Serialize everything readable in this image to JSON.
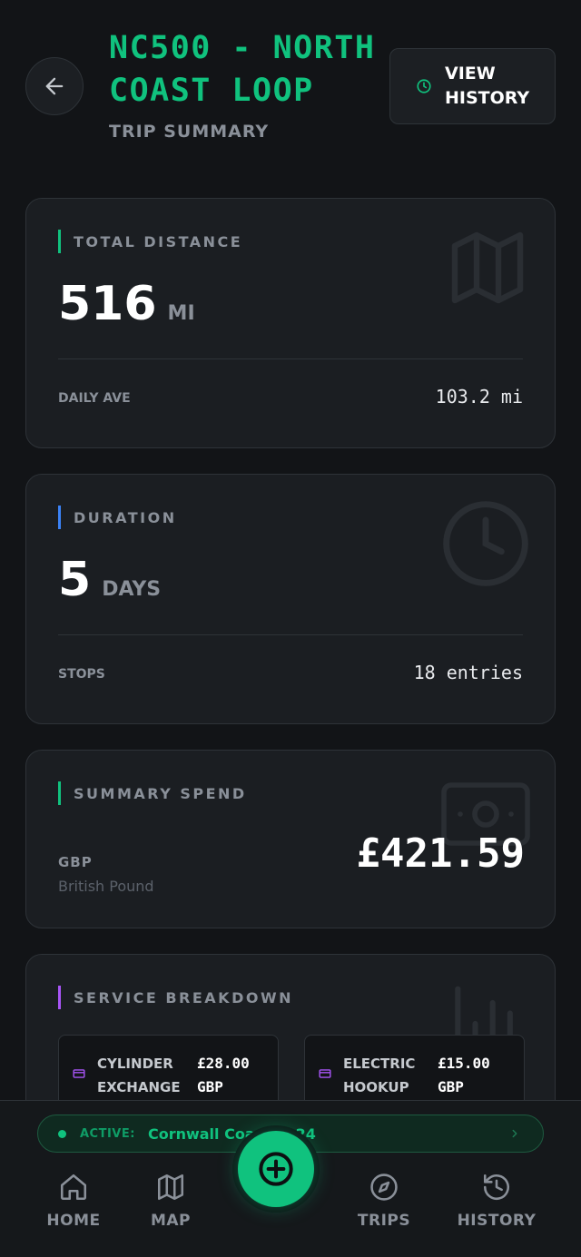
{
  "header": {
    "title": "NC500 - NORTH COAST LOOP",
    "subtitle": "TRIP SUMMARY",
    "history_button": "VIEW HISTORY"
  },
  "distance": {
    "label": "TOTAL DISTANCE",
    "value": "516",
    "unit": "MI",
    "row_key": "DAILY AVE",
    "row_value": "103.2 mi"
  },
  "duration": {
    "label": "DURATION",
    "value": "5",
    "unit": "DAYS",
    "row_key": "STOPS",
    "row_value": "18 entries"
  },
  "spend": {
    "label": "SUMMARY SPEND",
    "currency_code": "GBP",
    "currency_name": "British Pound",
    "value": "£421.59"
  },
  "services": {
    "label": "SERVICE BREAKDOWN",
    "items": [
      {
        "name": "CYLINDER EXCHANGE",
        "price": "£28.00 GBP"
      },
      {
        "name": "ELECTRIC HOOKUP",
        "price": "£15.00 GBP"
      }
    ]
  },
  "active_trip": {
    "key": "ACTIVE:",
    "name": "Cornwall Coast 2024"
  },
  "nav": {
    "home": "HOME",
    "map": "MAP",
    "trips": "TRIPS",
    "history": "HISTORY"
  },
  "colors": {
    "accent_green": "#10c27e",
    "accent_blue": "#3b82f6",
    "accent_purple": "#a855f7",
    "background": "#121417",
    "card": "#1b1e22"
  },
  "icons": {
    "back": "arrow-left-icon",
    "history_button": "clock-icon",
    "distance_card": "map-icon",
    "duration_card": "clock-icon",
    "spend_card": "banknote-icon",
    "services_card": "bar-chart-icon",
    "service_item": "credit-card-icon",
    "fab": "plus-circle-icon"
  }
}
